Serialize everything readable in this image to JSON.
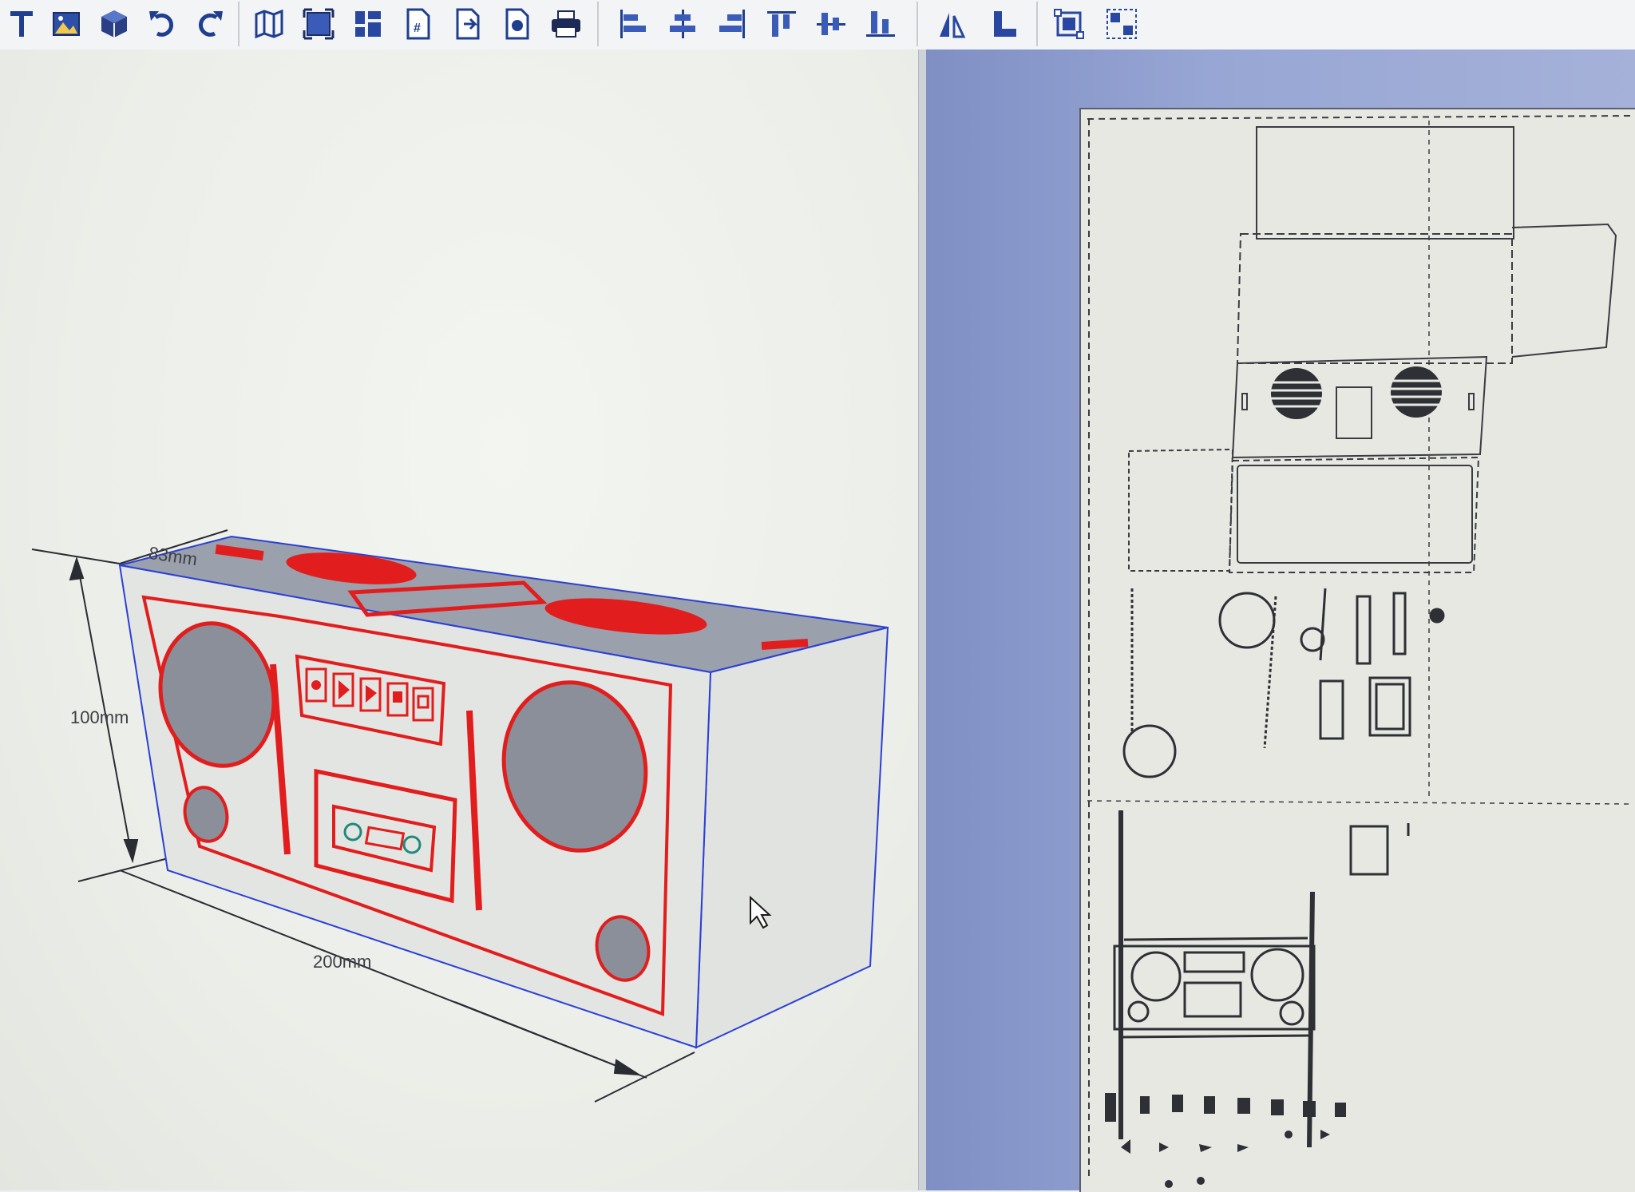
{
  "toolbar": {
    "items": [
      {
        "name": "text-tool",
        "icon": "text-icon",
        "glyph": "T"
      },
      {
        "name": "image-tool",
        "icon": "image-icon"
      },
      {
        "name": "3d-model-tool",
        "icon": "cube-icon"
      },
      {
        "name": "undo",
        "icon": "undo-icon"
      },
      {
        "name": "redo",
        "icon": "redo-icon"
      },
      {
        "name": "unfold-map",
        "icon": "map-icon"
      },
      {
        "name": "fit-view",
        "icon": "fit-icon"
      },
      {
        "name": "arrange-parts",
        "icon": "arrange-icon"
      },
      {
        "name": "page-number",
        "icon": "page-number-icon",
        "glyph": "#"
      },
      {
        "name": "page-next",
        "icon": "page-arrow-icon"
      },
      {
        "name": "page-object",
        "icon": "page-object-icon"
      },
      {
        "name": "print",
        "icon": "printer-icon"
      },
      {
        "name": "align-left",
        "icon": "align-left-icon"
      },
      {
        "name": "align-center-h",
        "icon": "align-center-icon"
      },
      {
        "name": "align-right",
        "icon": "align-right-icon"
      },
      {
        "name": "align-top",
        "icon": "align-top-icon"
      },
      {
        "name": "align-middle-v",
        "icon": "align-middle-icon"
      },
      {
        "name": "align-bottom",
        "icon": "align-bottom-icon"
      },
      {
        "name": "flip-horizontal",
        "icon": "flip-horizontal-icon"
      },
      {
        "name": "flip-vertical",
        "icon": "flip-vertical-icon"
      },
      {
        "name": "group",
        "icon": "group-icon"
      },
      {
        "name": "ungroup",
        "icon": "ungroup-icon"
      }
    ]
  },
  "preview": {
    "dimensions": {
      "depth": "83mm",
      "height": "100mm",
      "width": "200mm"
    },
    "colors": {
      "edge_red": "#e21d1d",
      "edge_blue": "#2c3fd6",
      "surface": "#e2e4e1",
      "speaker_fill": "#8a8f9a"
    }
  },
  "layout": {
    "background_color": "#9aa8d6",
    "sheet_color": "#e7e8e2"
  }
}
